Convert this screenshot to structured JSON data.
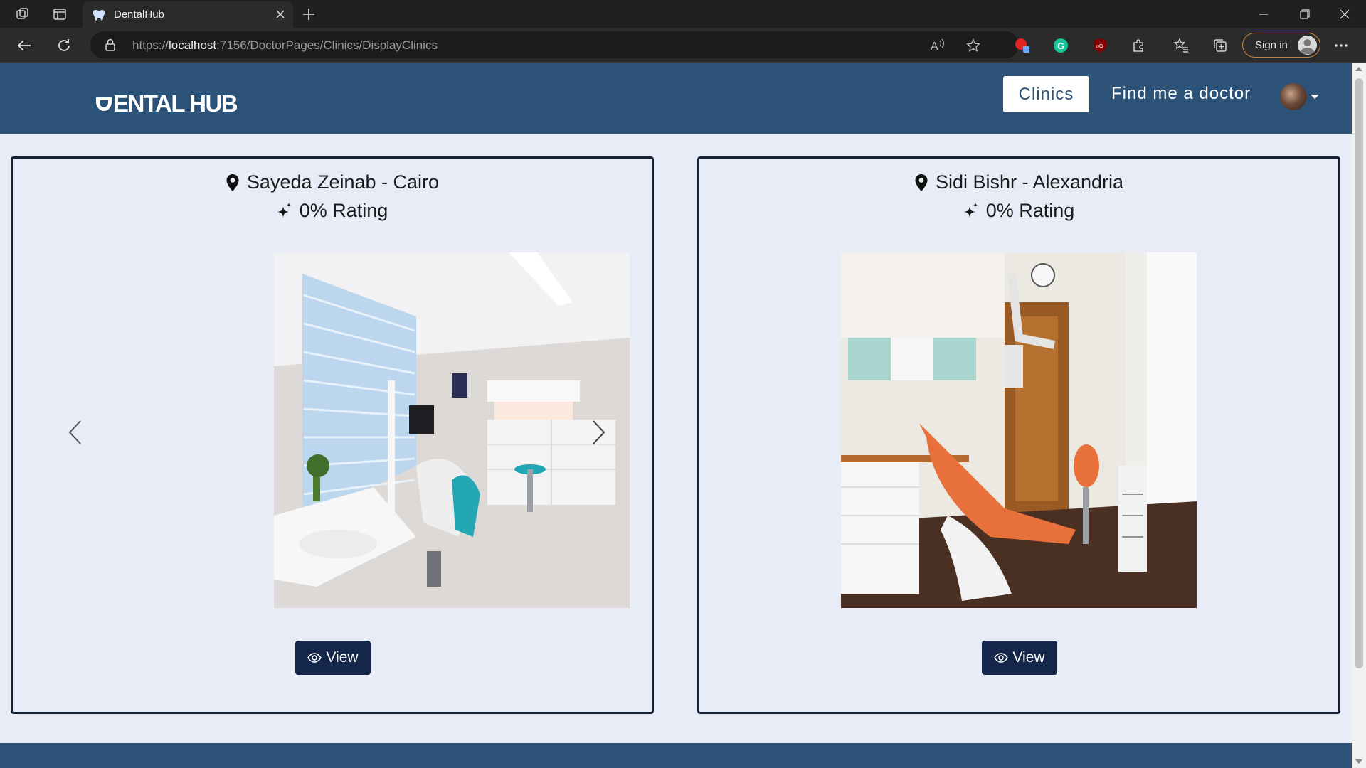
{
  "browser": {
    "tab_title": "DentalHub",
    "url_prefix": "https://",
    "url_host": "localhost",
    "url_path": ":7156/DoctorPages/Clinics/DisplayClinics",
    "signin_label": "Sign in"
  },
  "site": {
    "logo_text": "ENTAL HUB",
    "nav": {
      "clinics_label": "Clinics",
      "find_doctor_label": "Find me a doctor"
    },
    "colors": {
      "header": "#2d5278",
      "page_bg": "#e8ecf7",
      "button": "#14274a"
    }
  },
  "clinics": [
    {
      "location": "Sayeda Zeinab - Cairo",
      "rating": "0% Rating",
      "view_label": "View",
      "icon_location": "map-pin-icon",
      "icon_rating": "sparkle-icon",
      "has_carousel": true
    },
    {
      "location": "Sidi Bishr - Alexandria",
      "rating": "0% Rating",
      "view_label": "View",
      "icon_location": "map-pin-icon",
      "icon_rating": "sparkle-icon",
      "has_carousel": false
    }
  ]
}
